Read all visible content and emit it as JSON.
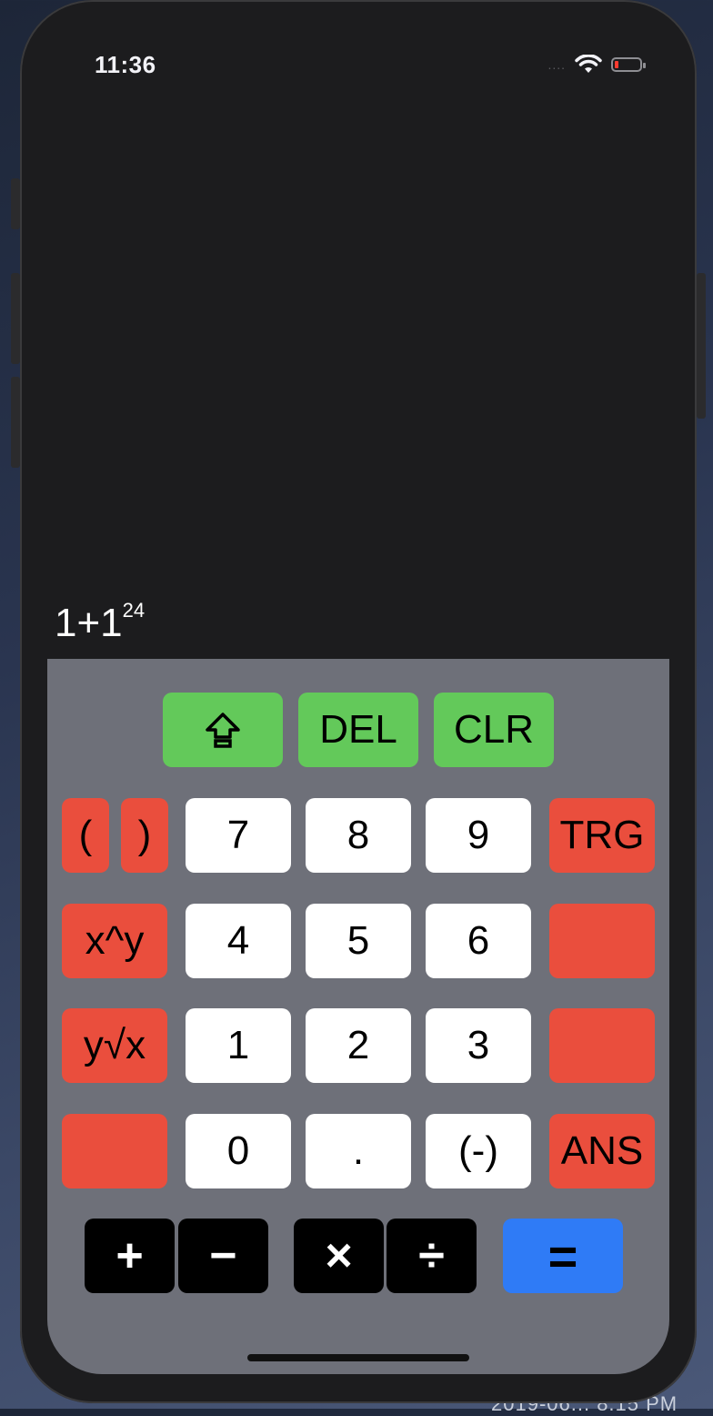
{
  "desktop": {
    "caption": "2019-06... 8.15 PM"
  },
  "status_bar": {
    "time": "11:36",
    "signal": "....",
    "wifi_icon": "wifi-icon",
    "battery_color": "#ff3b30"
  },
  "display": {
    "expression_base": "1+1",
    "expression_exponent": "24"
  },
  "keys": {
    "shift_icon": "shift-arrow-icon",
    "del": "DEL",
    "clr": "CLR",
    "open_paren": "(",
    "close_paren": ")",
    "seven": "7",
    "eight": "8",
    "nine": "9",
    "trg": "TRG",
    "pow": "x^y",
    "four": "4",
    "five": "5",
    "six": "6",
    "root": "y√x",
    "one": "1",
    "two": "2",
    "three": "3",
    "zero": "0",
    "dot": ".",
    "neg": "(-)",
    "ans": "ANS",
    "plus": "+",
    "minus": "−",
    "times": "×",
    "divide": "÷",
    "equals": "="
  },
  "colors": {
    "green": "#63c95a",
    "red": "#ea4e3d",
    "white": "#ffffff",
    "black": "#000000",
    "blue": "#2f7bf6",
    "keypad_bg": "#6e7079"
  }
}
